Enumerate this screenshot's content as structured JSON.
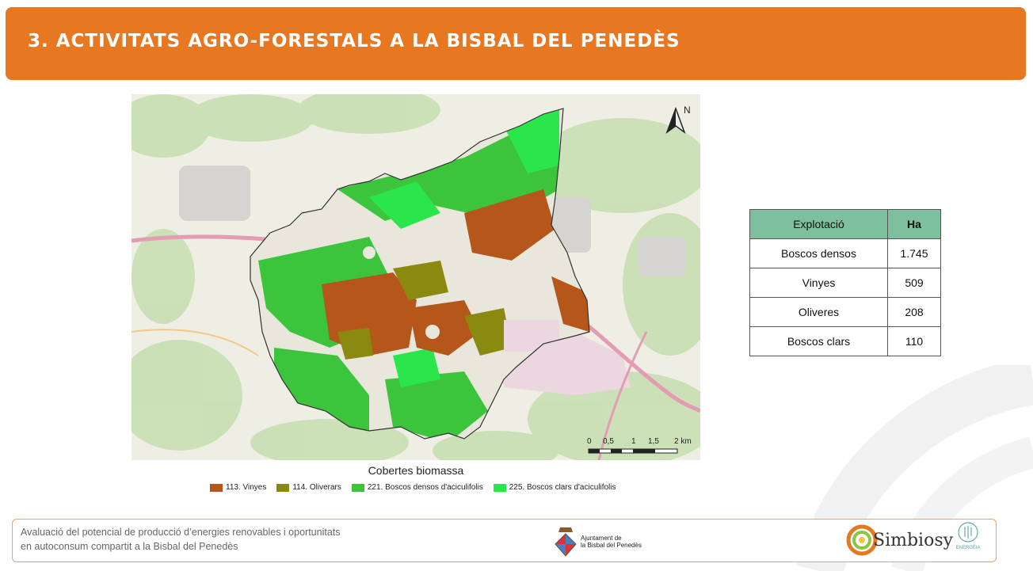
{
  "header": {
    "title": "3. ACTIVITATS AGRO-FORESTALS A LA BISBAL DEL PENEDÈS"
  },
  "map": {
    "north_label": "N",
    "scale_labels": [
      "0",
      "0,5",
      "1",
      "1,5",
      "2 km"
    ]
  },
  "legend": {
    "title": "Cobertes biomassa",
    "items": [
      {
        "label": "113. Vinyes",
        "color": "#b5561a"
      },
      {
        "label": "114. Oliverars",
        "color": "#8a8a10"
      },
      {
        "label": "221. Boscos densos d'aciculifolis",
        "color": "#3cc43c"
      },
      {
        "label": "225. Boscos clars d'aciculifolis",
        "color": "#2ae64a"
      }
    ]
  },
  "table": {
    "headers": [
      "Explotació",
      "Ha"
    ],
    "rows": [
      {
        "name": "Boscos densos",
        "ha": "1.745"
      },
      {
        "name": "Vinyes",
        "ha": "509"
      },
      {
        "name": "Oliveres",
        "ha": "208"
      },
      {
        "name": "Boscos clars",
        "ha": "110"
      }
    ],
    "header_color": "#7dbf9e"
  },
  "footer": {
    "line1": "Avaluació del potencial de producció d’energies renovables i oportunitats",
    "line2": "en autoconsum compartit a la Bisbal del Penedès",
    "ajuntament_line1": "Ajuntament de",
    "ajuntament_line2": "la Bisbal del Penedès",
    "simbiosy": "Simbiosy",
    "energia": "ENERGÈIA"
  },
  "colors": {
    "accent": "#e87722"
  }
}
